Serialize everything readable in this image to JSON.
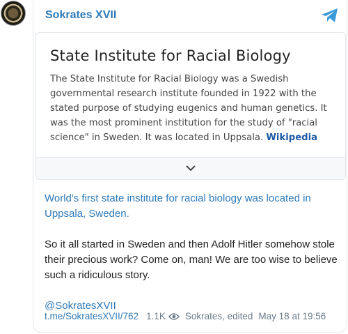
{
  "channel": {
    "name": "Sokrates XVII"
  },
  "preview": {
    "title": "State Institute for Racial Biology",
    "text": "The State Institute for Racial Biology was a Swedish governmental research institute founded in 1922 with the stated purpose of studying eugenics and human genetics. It was the most prominent institution for the study of \"racial science\" in Sweden. It was located in Uppsala.",
    "source": "Wikipedia"
  },
  "message": {
    "link_text": "World's first state institute for racial biology was located in Uppsala, Sweden.",
    "body": "So it all started in Sweden and then Adolf Hitler somehow stole their precious work? Come on, man! We are too wise to believe such a ridiculous story.",
    "mention": "@SokratesXVII"
  },
  "footer": {
    "post_link": "t.me/SokratesXVII/762",
    "views": "1.1K",
    "author": "Sokrates, edited",
    "date": "May 18 at 19:56"
  },
  "colors": {
    "accent": "#2f7ab7",
    "muted": "#6b7b8a",
    "wiki": "#1e5aa6"
  }
}
